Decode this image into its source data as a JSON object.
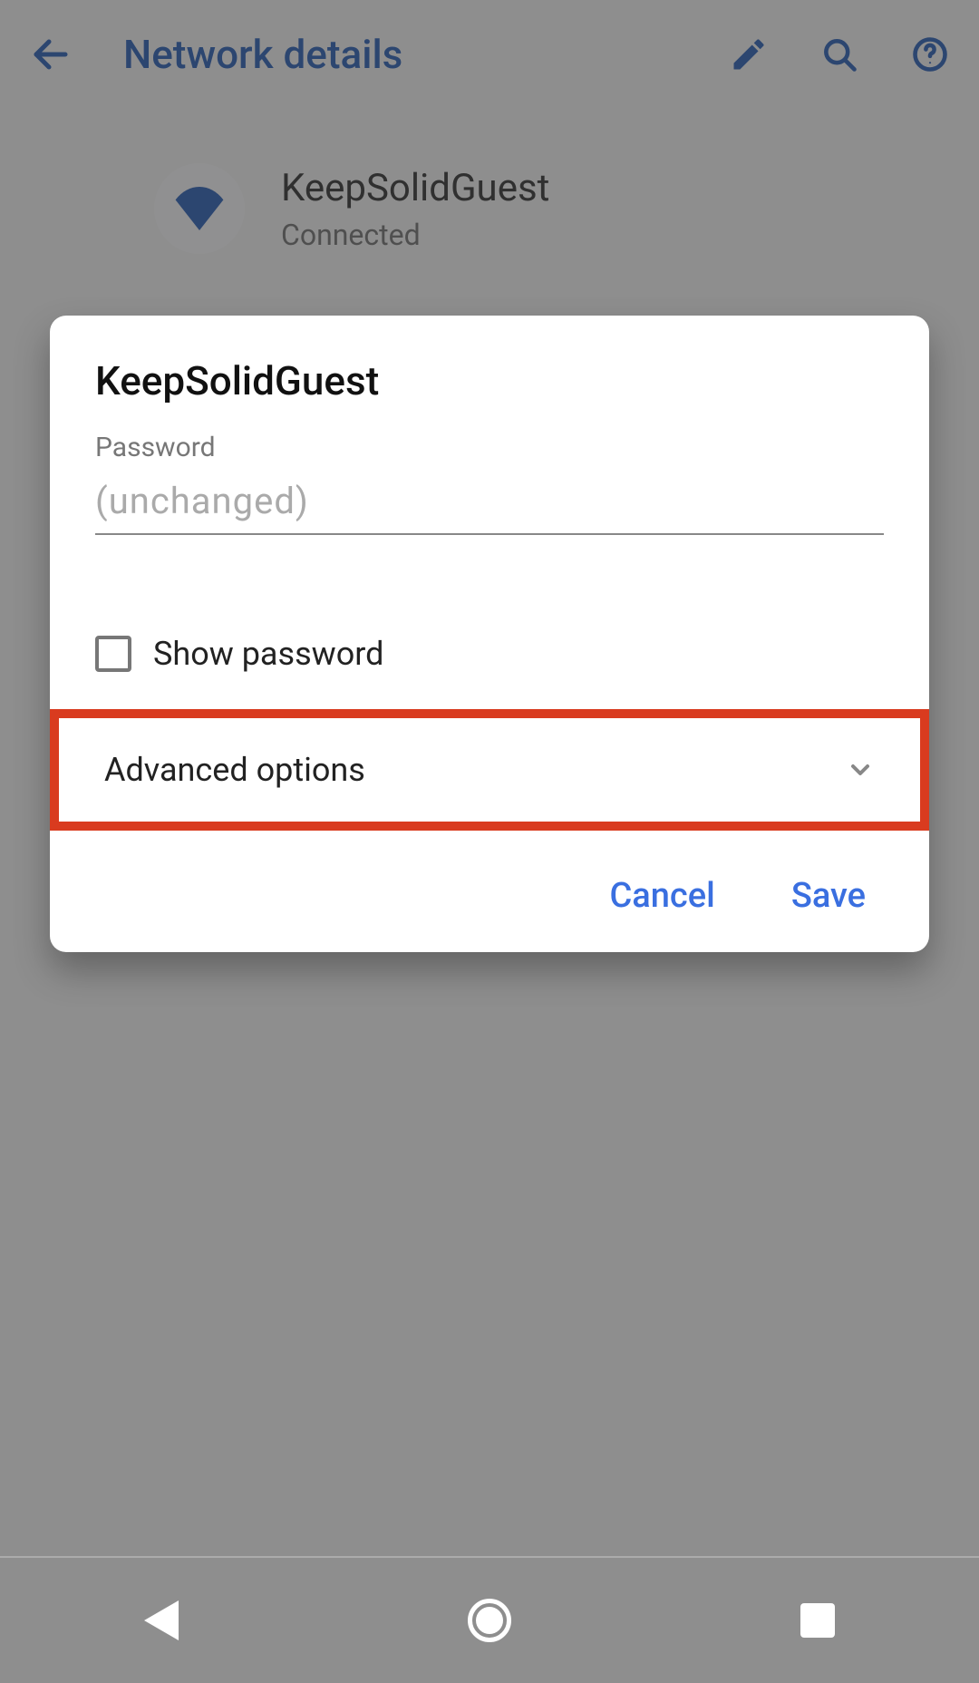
{
  "colors": {
    "accent": "#1a53b0",
    "link": "#3a6fe0",
    "highlight_border": "#d93b1f"
  },
  "appbar": {
    "title": "Network details"
  },
  "network": {
    "name": "KeepSolidGuest",
    "status": "Connected"
  },
  "dialog": {
    "title": "KeepSolidGuest",
    "password_label": "Password",
    "password_placeholder": "(unchanged)",
    "password_value": "",
    "show_password_label": "Show password",
    "show_password_checked": false,
    "advanced_label": "Advanced options",
    "cancel_label": "Cancel",
    "save_label": "Save"
  },
  "icons": {
    "back": "back-arrow-icon",
    "edit": "pencil-icon",
    "search": "search-icon",
    "help": "help-icon",
    "wifi": "wifi-icon",
    "chevron_down": "chevron-down-icon"
  }
}
